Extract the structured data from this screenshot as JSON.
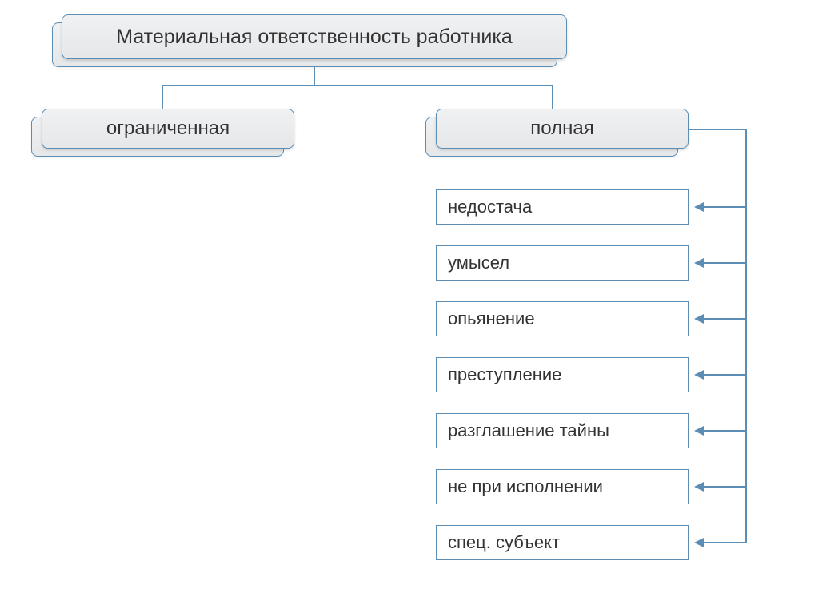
{
  "root": {
    "label": "Материальная ответственность работника"
  },
  "children": [
    {
      "label": "ограниченная"
    },
    {
      "label": "полная"
    }
  ],
  "full_cases": [
    "недостача",
    "умысел",
    "опьянение",
    "преступление",
    "разглашение тайны",
    "не при исполнении",
    "спец. субъект"
  ],
  "colors": {
    "border": "#5b8db5",
    "text": "#333333"
  }
}
